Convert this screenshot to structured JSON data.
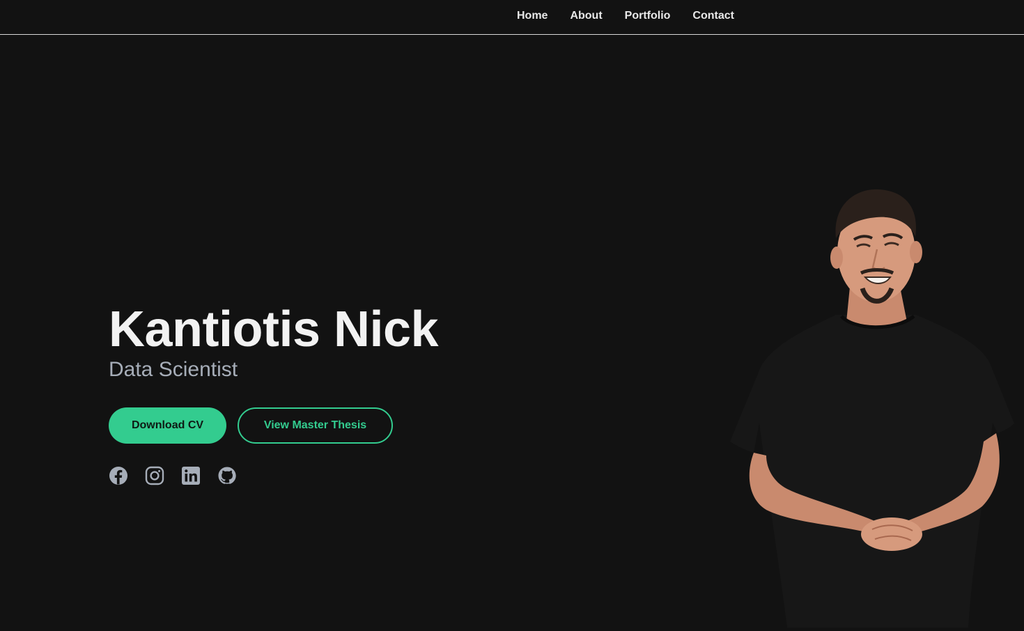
{
  "nav": {
    "items": [
      {
        "label": "Home"
      },
      {
        "label": "About"
      },
      {
        "label": "Portfolio"
      },
      {
        "label": "Contact"
      }
    ]
  },
  "hero": {
    "name": "Kantiotis Nick",
    "role": "Data Scientist",
    "primary_button": "Download CV",
    "secondary_button": "View Master Thesis"
  },
  "socials": [
    {
      "icon": "facebook-icon"
    },
    {
      "icon": "instagram-icon"
    },
    {
      "icon": "linkedin-icon"
    },
    {
      "icon": "github-icon"
    }
  ],
  "colors": {
    "background": "#121212",
    "accent": "#33cc8f",
    "text": "#f2f2f2",
    "muted": "#a6adb8"
  }
}
